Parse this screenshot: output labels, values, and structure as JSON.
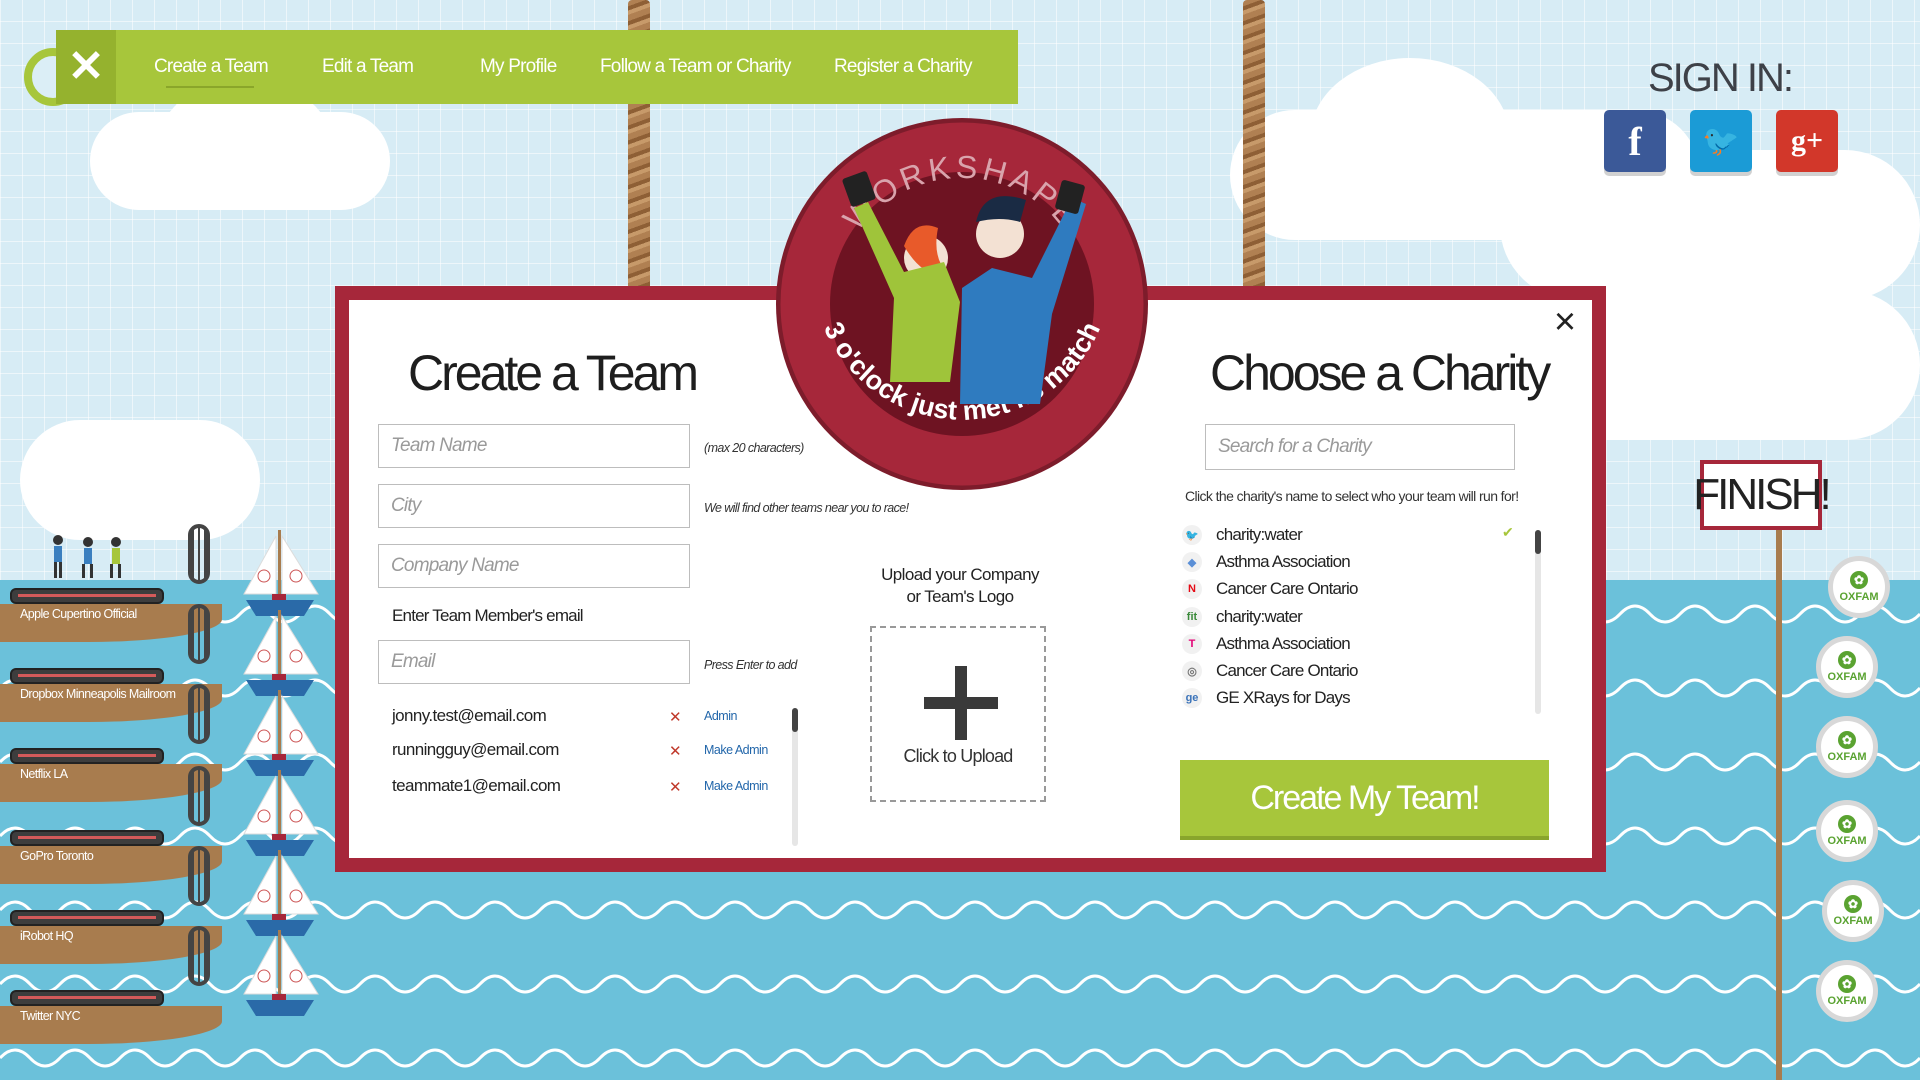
{
  "nav": {
    "items": [
      {
        "label": "Create a Team"
      },
      {
        "label": "Edit a Team"
      },
      {
        "label": "My Profile"
      },
      {
        "label": "Follow a Team or Charity"
      },
      {
        "label": "Register a Charity"
      }
    ]
  },
  "signin": {
    "title": "SIGN IN:",
    "providers": [
      {
        "icon": "facebook-icon",
        "glyph": "f",
        "color": "#3b5998"
      },
      {
        "icon": "twitter-icon",
        "glyph": "🐦",
        "color": "#1b9bd6"
      },
      {
        "icon": "google-plus-icon",
        "glyph": "g+",
        "color": "#d2372a"
      }
    ]
  },
  "docks": [
    {
      "label": "Apple Cupertino Official"
    },
    {
      "label": "Dropbox Minneapolis Mailroom"
    },
    {
      "label": "Netflix LA"
    },
    {
      "label": "GoPro Toronto"
    },
    {
      "label": "iRobot HQ"
    },
    {
      "label": "Twitter NYC"
    }
  ],
  "finish": {
    "label": "FINISH!"
  },
  "oxfam": {
    "label": "OXFAM"
  },
  "badge": {
    "brand": "WORKSHAPE",
    "tagline": "3 o'clock just met its match"
  },
  "modal": {
    "create_team": {
      "heading": "Create a Team",
      "team_name": {
        "placeholder": "Team Name",
        "hint": "(max 20 characters)"
      },
      "city": {
        "placeholder": "City",
        "hint": "We will find other teams near you to race!"
      },
      "company": {
        "placeholder": "Company Name"
      },
      "members_label": "Enter Team Member's email",
      "email": {
        "placeholder": "Email",
        "hint": "Press Enter to add"
      },
      "members": [
        {
          "email": "jonny.test@email.com",
          "action": "Admin"
        },
        {
          "email": "runningguy@email.com",
          "action": "Make Admin"
        },
        {
          "email": "teammate1@email.com",
          "action": "Make Admin"
        }
      ]
    },
    "upload": {
      "label_line1": "Upload your Company",
      "label_line2": "or Team's Logo",
      "button": "Click to Upload"
    },
    "charity": {
      "heading": "Choose a Charity",
      "search_placeholder": "Search for a Charity",
      "instruction": "Click the charity's name to select who your team will run for!",
      "items": [
        {
          "name": "charity:water",
          "icon": "twitter-icon",
          "glyph": "🐦",
          "color": "#1b9bd6",
          "selected": true
        },
        {
          "name": "Asthma Association",
          "icon": "dropbox-icon",
          "glyph": "◆",
          "color": "#5b8fd6",
          "selected": false
        },
        {
          "name": "Cancer Care Ontario",
          "icon": "netflix-icon",
          "glyph": "N",
          "color": "#e50914",
          "selected": false
        },
        {
          "name": "charity:water",
          "icon": "fitbit-icon",
          "glyph": "fit",
          "color": "#3a8a3a",
          "selected": false
        },
        {
          "name": "Asthma Association",
          "icon": "tmobile-icon",
          "glyph": "T",
          "color": "#e20074",
          "selected": false
        },
        {
          "name": "Cancer Care Ontario",
          "icon": "gopro-icon",
          "glyph": "◎",
          "color": "#777777",
          "selected": false
        },
        {
          "name": "GE XRays for Days",
          "icon": "ge-icon",
          "glyph": "ge",
          "color": "#3b73b9",
          "selected": false
        }
      ],
      "check": "✔"
    },
    "submit": "Create My Team!",
    "close": "×"
  },
  "colors": {
    "nav_green": "#a7c63b",
    "modal_red": "#a6273a",
    "sea": "#6bc1da",
    "dock_wood": "#a87c4e"
  }
}
